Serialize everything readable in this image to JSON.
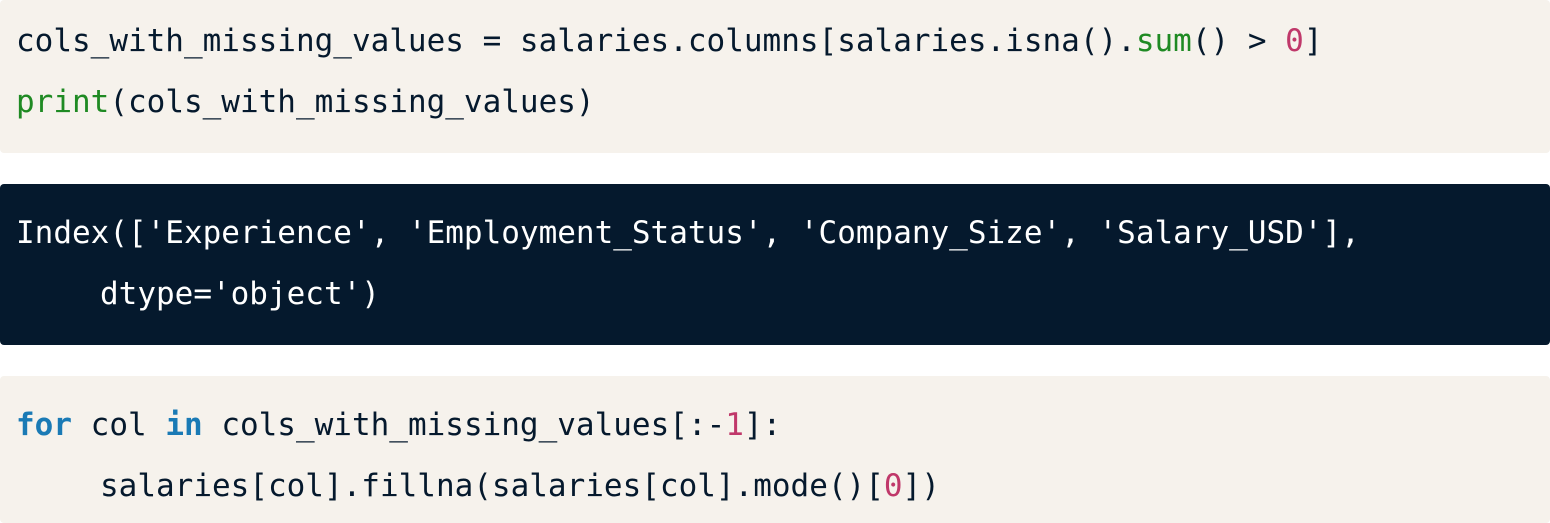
{
  "code_cell_1": {
    "line_1": {
      "pre": "cols_with_missing_values = salaries.columns[salaries.isna().",
      "fn": "sum",
      "mid": "() > ",
      "num": "0",
      "post": "]"
    },
    "line_2": {
      "fn": "print",
      "post": "(cols_with_missing_values)"
    }
  },
  "output_cell": {
    "line_1": "Index(['Experience', 'Employment_Status', 'Company_Size', 'Salary_USD'],",
    "line_2": "dtype='object')"
  },
  "code_cell_2": {
    "line_1": {
      "kw1": "for",
      "t1": " col ",
      "kw2": "in",
      "t2": " cols_with_missing_values[:-",
      "num": "1",
      "post": "]:"
    },
    "line_2": {
      "pre": "salaries[col].fillna(salaries[col].mode()[",
      "num": "0",
      "post": "])"
    }
  },
  "colors": {
    "code_background": "#f6f2ec",
    "output_background": "#05192d",
    "code_text": "#05192d",
    "output_text": "#ffffff",
    "builtin_function": "#1f8a23",
    "number_literal": "#c0386a",
    "keyword": "#1a7ab5"
  }
}
